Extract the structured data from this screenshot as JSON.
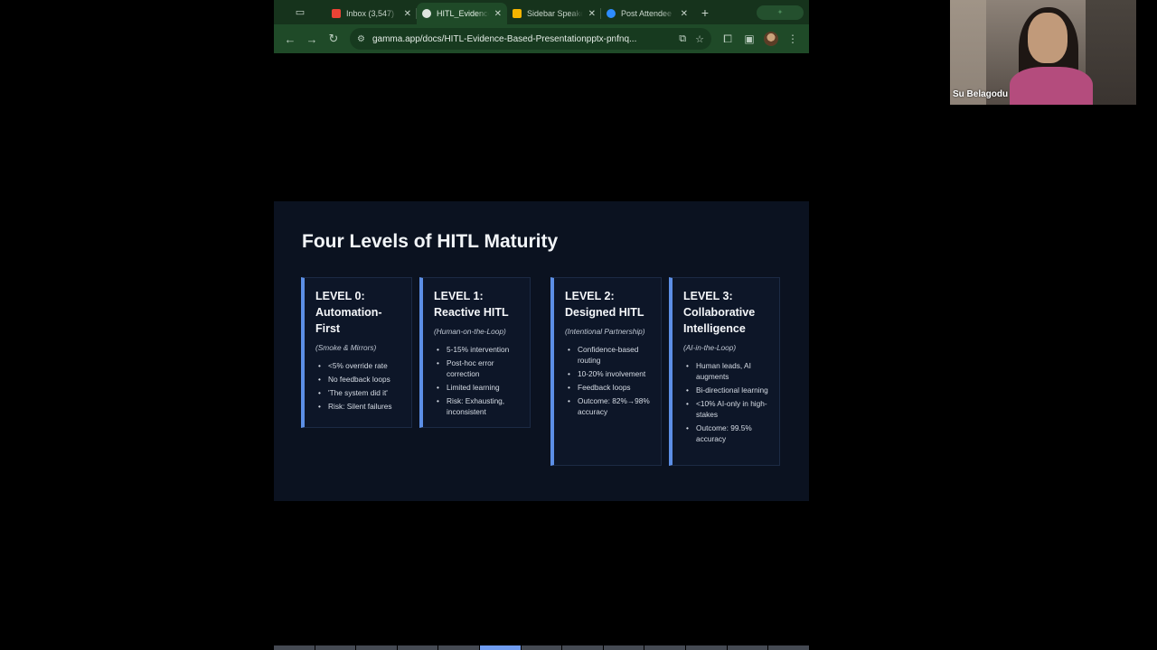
{
  "browser": {
    "tabs": [
      {
        "label": "Inbox (3,547)",
        "favicon": "gmail-icon",
        "color": "#ea4335",
        "active": false
      },
      {
        "label": "HITL_Evidence",
        "favicon": "gamma-icon",
        "color": "#dfe6e0",
        "active": true
      },
      {
        "label": "Sidebar Speaker",
        "favicon": "slides-icon",
        "color": "#f4b400",
        "active": false
      },
      {
        "label": "Post Attendee",
        "favicon": "zoom-icon",
        "color": "#2d8cff",
        "active": false
      }
    ],
    "url": "gamma.app/docs/HITL-Evidence-Based-Presentationpptx-pnfnq..."
  },
  "slide": {
    "title": "Four Levels of HITL Maturity",
    "cards": [
      {
        "title": "LEVEL 0: Automation-First",
        "subtitle": "(Smoke & Mirrors)",
        "bullets": [
          "<5% override rate",
          "No feedback loops",
          "'The system did it'",
          "Risk: Silent failures"
        ]
      },
      {
        "title": "LEVEL 1: Reactive HITL",
        "subtitle": "(Human-on-the-Loop)",
        "bullets": [
          "5-15% intervention",
          "Post-hoc error correction",
          "Limited learning",
          "Risk: Exhausting, inconsistent"
        ]
      },
      {
        "title": "LEVEL 2: Designed HITL",
        "subtitle": "(Intentional Partnership)",
        "bullets": [
          "Confidence-based routing",
          "10-20% involvement",
          "Feedback loops",
          "Outcome: 82%→98% accuracy"
        ]
      },
      {
        "title": "LEVEL 3: Collaborative Intelligence",
        "subtitle": "(AI-in-the-Loop)",
        "bullets": [
          "Human leads, AI augments",
          "Bi-directional learning",
          "<10% AI-only in high-stakes",
          "Outcome: 99.5% accuracy"
        ]
      }
    ]
  },
  "participant": {
    "name": "Su Belagodu"
  },
  "colors": {
    "accent": "#5c8fe6",
    "slide_bg": "#0b1220",
    "browser_frame": "#1f4a28"
  }
}
